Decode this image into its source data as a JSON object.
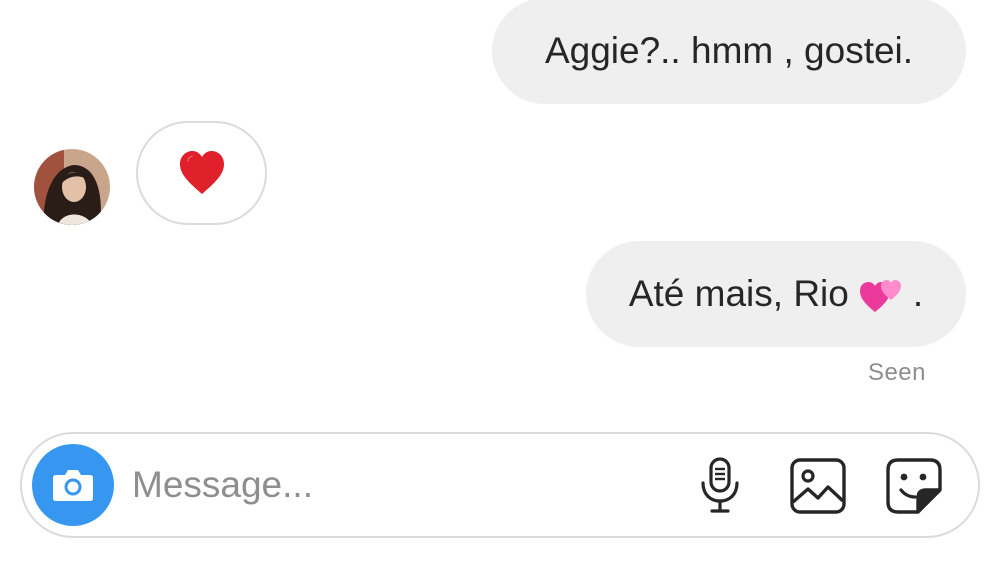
{
  "thread": {
    "messages": [
      {
        "direction": "outgoing",
        "text": "Aggie?.. hmm , gostei."
      },
      {
        "direction": "incoming",
        "type": "emoji",
        "emoji": "red-heart-icon"
      },
      {
        "direction": "outgoing",
        "text": "Até mais, Rio",
        "emoji": "two-hearts-icon",
        "suffix": "."
      }
    ],
    "status": "Seen"
  },
  "composer": {
    "placeholder": "Message...",
    "value": "",
    "icons": [
      "camera-icon",
      "microphone-icon",
      "gallery-icon",
      "sticker-icon"
    ],
    "accent": "#3797f0"
  }
}
